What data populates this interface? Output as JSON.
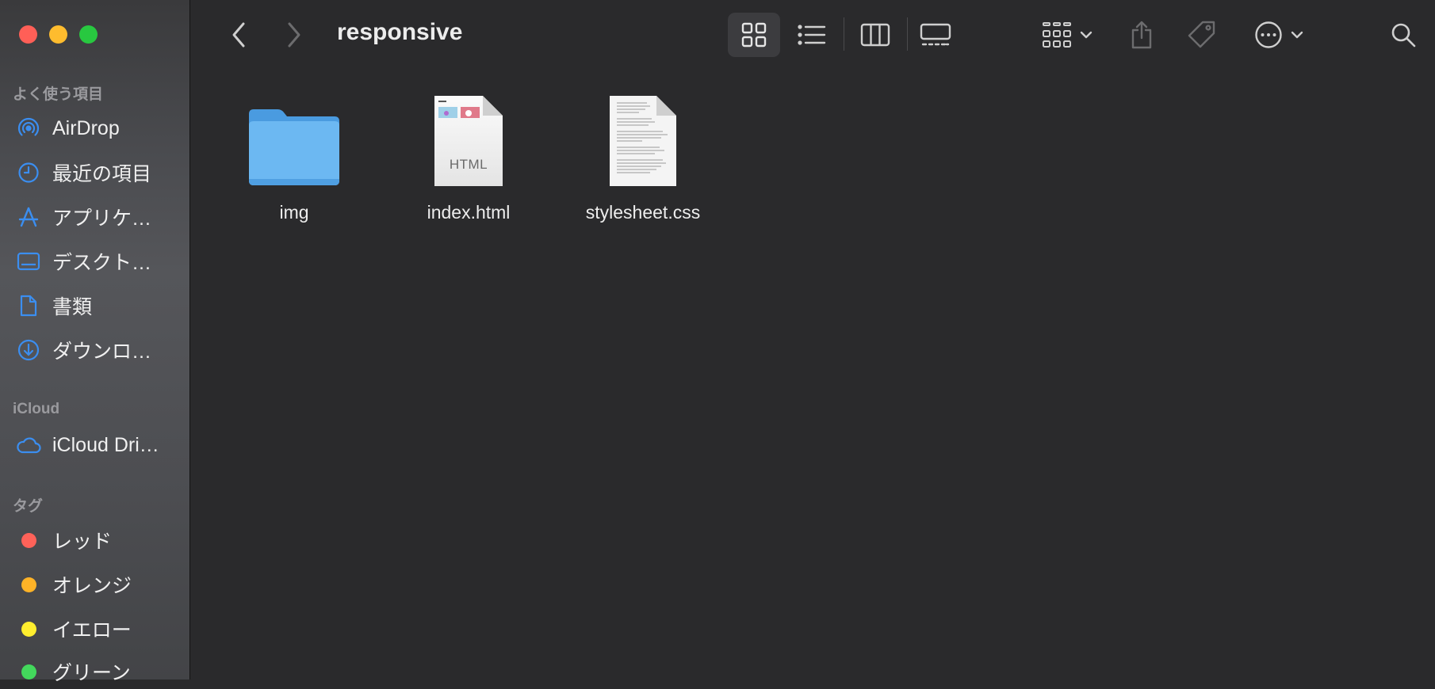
{
  "window": {
    "title": "responsive"
  },
  "sidebar": {
    "favorites_header": "よく使う項目",
    "favorites": [
      {
        "label": "AirDrop",
        "icon": "airdrop-icon"
      },
      {
        "label": "最近の項目",
        "icon": "clock-icon"
      },
      {
        "label": "アプリケ…",
        "icon": "applications-icon"
      },
      {
        "label": "デスクト…",
        "icon": "desktop-icon"
      },
      {
        "label": "書類",
        "icon": "document-icon"
      },
      {
        "label": "ダウンロ…",
        "icon": "download-icon"
      }
    ],
    "icloud_header": "iCloud",
    "icloud": [
      {
        "label": "iCloud Dri…",
        "icon": "cloud-icon"
      }
    ],
    "tags_header": "タグ",
    "tags": [
      {
        "label": "レッド",
        "color": "#ff6259"
      },
      {
        "label": "オレンジ",
        "color": "#ffb327"
      },
      {
        "label": "イエロー",
        "color": "#ffee2e"
      },
      {
        "label": "グリーン",
        "color": "#43d85c"
      }
    ]
  },
  "files": [
    {
      "name": "img",
      "kind": "folder-icon"
    },
    {
      "name": "index.html",
      "kind": "html-file-icon",
      "badge": "HTML"
    },
    {
      "name": "stylesheet.css",
      "kind": "css-file-icon"
    }
  ],
  "colors": {
    "accent": "#3b8ef0",
    "folder": "#6cb8f2"
  }
}
